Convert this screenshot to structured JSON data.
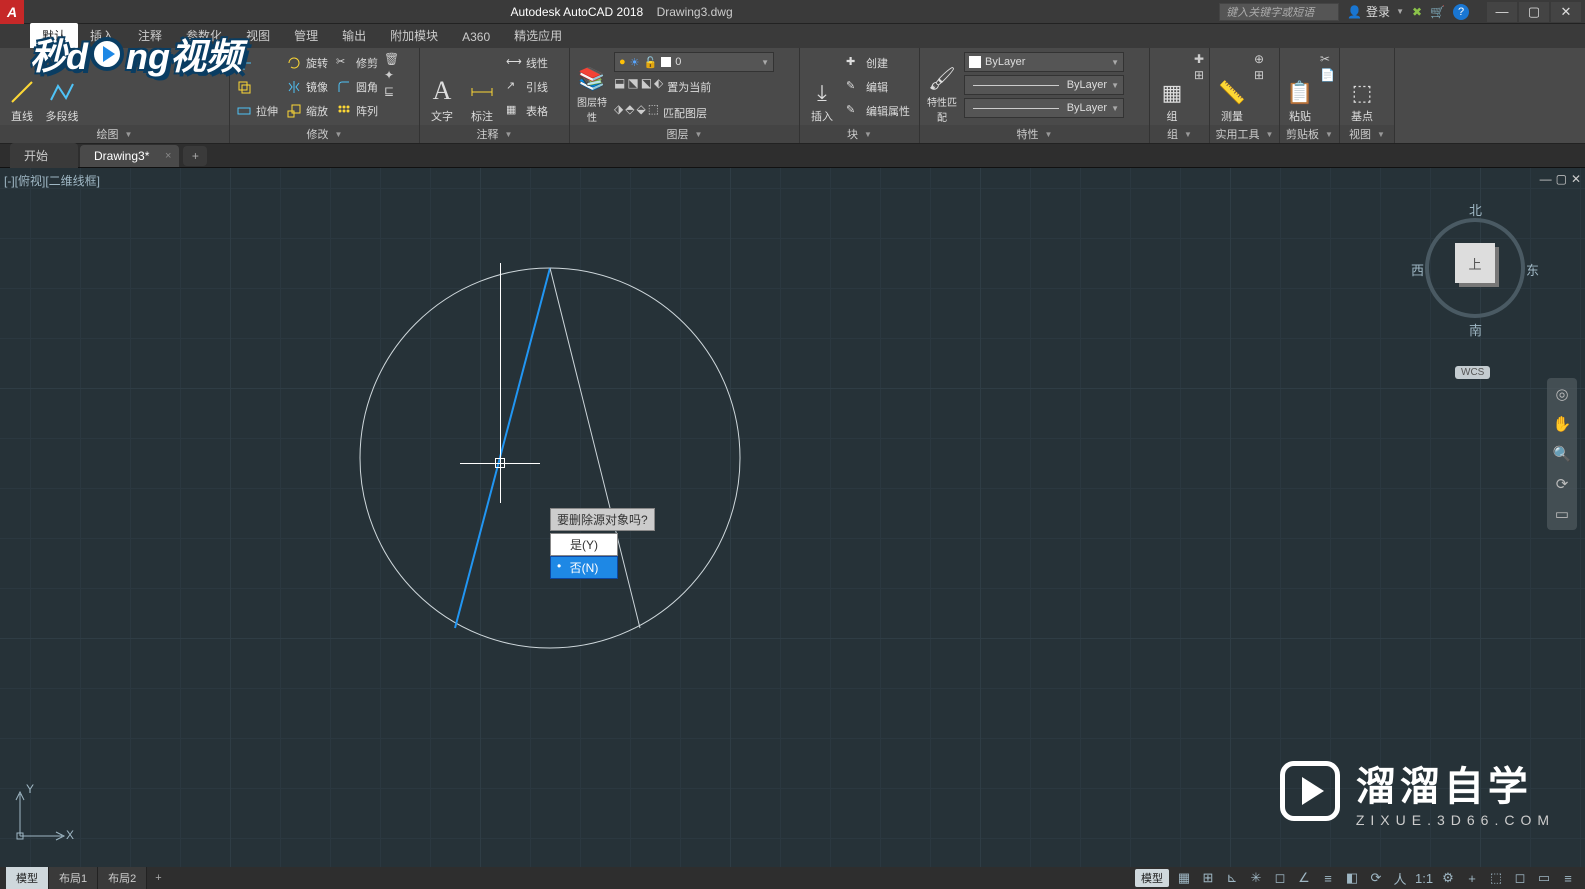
{
  "title": {
    "app": "Autodesk AutoCAD 2018",
    "file": "Drawing3.dwg"
  },
  "search_placeholder": "键入关键字或短语",
  "login_label": "登录",
  "menu_tabs": [
    "默认",
    "插入",
    "注释",
    "参数化",
    "视图",
    "管理",
    "输出",
    "附加模块",
    "A360",
    "精选应用"
  ],
  "ribbon": {
    "draw": {
      "title": "绘图",
      "line": "直线",
      "polyline": "多段线"
    },
    "modify": {
      "title": "修改",
      "rotate": "旋转",
      "trim": "修剪",
      "mirror": "镜像",
      "fillet": "圆角",
      "stretch": "拉伸",
      "scale": "缩放",
      "array": "阵列"
    },
    "annotation": {
      "title": "注释",
      "text": "文字",
      "dim": "标注",
      "linear": "线性",
      "leader": "引线",
      "table": "表格"
    },
    "layers": {
      "title": "图层",
      "props": "图层特性",
      "current": "0",
      "setcurrent": "置为当前",
      "match": "匹配图层"
    },
    "block": {
      "title": "块",
      "insert": "插入",
      "create": "创建",
      "edit": "编辑",
      "editattr": "编辑属性"
    },
    "props": {
      "title": "特性",
      "match": "特性匹配",
      "bylayer": "ByLayer"
    },
    "groups": {
      "title": "组",
      "label": "组"
    },
    "utilities": {
      "title": "实用工具",
      "label": "测量"
    },
    "clipboard": {
      "title": "剪贴板",
      "label": "粘贴"
    },
    "view": {
      "title": "视图",
      "label": "基点"
    }
  },
  "file_tabs": {
    "start": "开始",
    "drawing": "Drawing3*"
  },
  "viewport_label": "[-][俯视][二维线框]",
  "viewcube": {
    "n": "北",
    "s": "南",
    "e": "东",
    "w": "西",
    "top": "上",
    "wcs": "WCS"
  },
  "prompt": {
    "label": "要删除源对象吗?",
    "yes": "是(Y)",
    "no": "否(N)"
  },
  "ucs": {
    "x": "X",
    "y": "Y"
  },
  "layout": {
    "model": "模型",
    "l1": "布局1",
    "l2": "布局2"
  },
  "status": {
    "model": "模型",
    "ratio": "1:1"
  },
  "watermark_br": {
    "t1": "溜溜自学",
    "t2": "ZIXUE.3D66.COM"
  },
  "watermark_logo": {
    "p1": "秒d",
    "p2": "ng视频"
  }
}
